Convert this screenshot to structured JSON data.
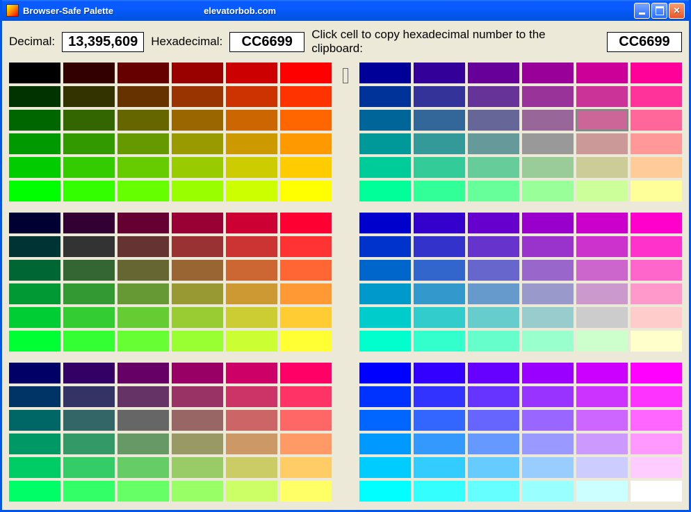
{
  "window": {
    "title": "Browser-Safe Palette",
    "site": "elevatorbob.com"
  },
  "toolbar": {
    "decimal_label": "Decimal:",
    "decimal_value": "13,395,609",
    "hex_label": "Hexadecimal:",
    "hex_value": "CC6699",
    "hint": "Click cell to copy hexadecimal number to the clipboard:",
    "hex_preview": "CC6699"
  },
  "selected_hex": "CC6699",
  "left_blocks": [
    [
      [
        "000000",
        "330000",
        "660000",
        "990000",
        "CC0000",
        "FF0000"
      ],
      [
        "003300",
        "333300",
        "663300",
        "993300",
        "CC3300",
        "FF3300"
      ],
      [
        "006600",
        "336600",
        "666600",
        "996600",
        "CC6600",
        "FF6600"
      ],
      [
        "009900",
        "339900",
        "669900",
        "999900",
        "CC9900",
        "FF9900"
      ],
      [
        "00CC00",
        "33CC00",
        "66CC00",
        "99CC00",
        "CCCC00",
        "FFCC00"
      ],
      [
        "00FF00",
        "33FF00",
        "66FF00",
        "99FF00",
        "CCFF00",
        "FFFF00"
      ]
    ],
    [
      [
        "000033",
        "330033",
        "660033",
        "990033",
        "CC0033",
        "FF0033"
      ],
      [
        "003333",
        "333333",
        "663333",
        "993333",
        "CC3333",
        "FF3333"
      ],
      [
        "006633",
        "336633",
        "666633",
        "996633",
        "CC6633",
        "FF6633"
      ],
      [
        "009933",
        "339933",
        "669933",
        "999933",
        "CC9933",
        "FF9933"
      ],
      [
        "00CC33",
        "33CC33",
        "66CC33",
        "99CC33",
        "CCCC33",
        "FFCC33"
      ],
      [
        "00FF33",
        "33FF33",
        "66FF33",
        "99FF33",
        "CCFF33",
        "FFFF33"
      ]
    ],
    [
      [
        "000066",
        "330066",
        "660066",
        "990066",
        "CC0066",
        "FF0066"
      ],
      [
        "003366",
        "333366",
        "663366",
        "993366",
        "CC3366",
        "FF3366"
      ],
      [
        "006666",
        "336666",
        "666666",
        "996666",
        "CC6666",
        "FF6666"
      ],
      [
        "009966",
        "339966",
        "669966",
        "999966",
        "CC9966",
        "FF9966"
      ],
      [
        "00CC66",
        "33CC66",
        "66CC66",
        "99CC66",
        "CCCC66",
        "FFCC66"
      ],
      [
        "00FF66",
        "33FF66",
        "66FF66",
        "99FF66",
        "CCFF66",
        "FFFF66"
      ]
    ]
  ],
  "right_blocks": [
    [
      [
        "000099",
        "330099",
        "660099",
        "990099",
        "CC0099",
        "FF0099"
      ],
      [
        "003399",
        "333399",
        "663399",
        "993399",
        "CC3399",
        "FF3399"
      ],
      [
        "006699",
        "336699",
        "666699",
        "996699",
        "CC6699",
        "FF6699"
      ],
      [
        "009999",
        "339999",
        "669999",
        "999999",
        "CC9999",
        "FF9999"
      ],
      [
        "00CC99",
        "33CC99",
        "66CC99",
        "99CC99",
        "CCCC99",
        "FFCC99"
      ],
      [
        "00FF99",
        "33FF99",
        "66FF99",
        "99FF99",
        "CCFF99",
        "FFFF99"
      ]
    ],
    [
      [
        "0000CC",
        "3300CC",
        "6600CC",
        "9900CC",
        "CC00CC",
        "FF00CC"
      ],
      [
        "0033CC",
        "3333CC",
        "6633CC",
        "9933CC",
        "CC33CC",
        "FF33CC"
      ],
      [
        "0066CC",
        "3366CC",
        "6666CC",
        "9966CC",
        "CC66CC",
        "FF66CC"
      ],
      [
        "0099CC",
        "3399CC",
        "6699CC",
        "9999CC",
        "CC99CC",
        "FF99CC"
      ],
      [
        "00CCCC",
        "33CCCC",
        "66CCCC",
        "99CCCC",
        "CCCCCC",
        "FFCCCC"
      ],
      [
        "00FFCC",
        "33FFCC",
        "66FFCC",
        "99FFCC",
        "CCFFCC",
        "FFFFCC"
      ]
    ],
    [
      [
        "0000FF",
        "3300FF",
        "6600FF",
        "9900FF",
        "CC00FF",
        "FF00FF"
      ],
      [
        "0033FF",
        "3333FF",
        "6633FF",
        "9933FF",
        "CC33FF",
        "FF33FF"
      ],
      [
        "0066FF",
        "3366FF",
        "6666FF",
        "9966FF",
        "CC66FF",
        "FF66FF"
      ],
      [
        "0099FF",
        "3399FF",
        "6699FF",
        "9999FF",
        "CC99FF",
        "FF99FF"
      ],
      [
        "00CCFF",
        "33CCFF",
        "66CCFF",
        "99CCFF",
        "CCCCFF",
        "FFCCFF"
      ],
      [
        "00FFFF",
        "33FFFF",
        "66FFFF",
        "99FFFF",
        "CCFFFF",
        "FFFFFF"
      ]
    ]
  ]
}
